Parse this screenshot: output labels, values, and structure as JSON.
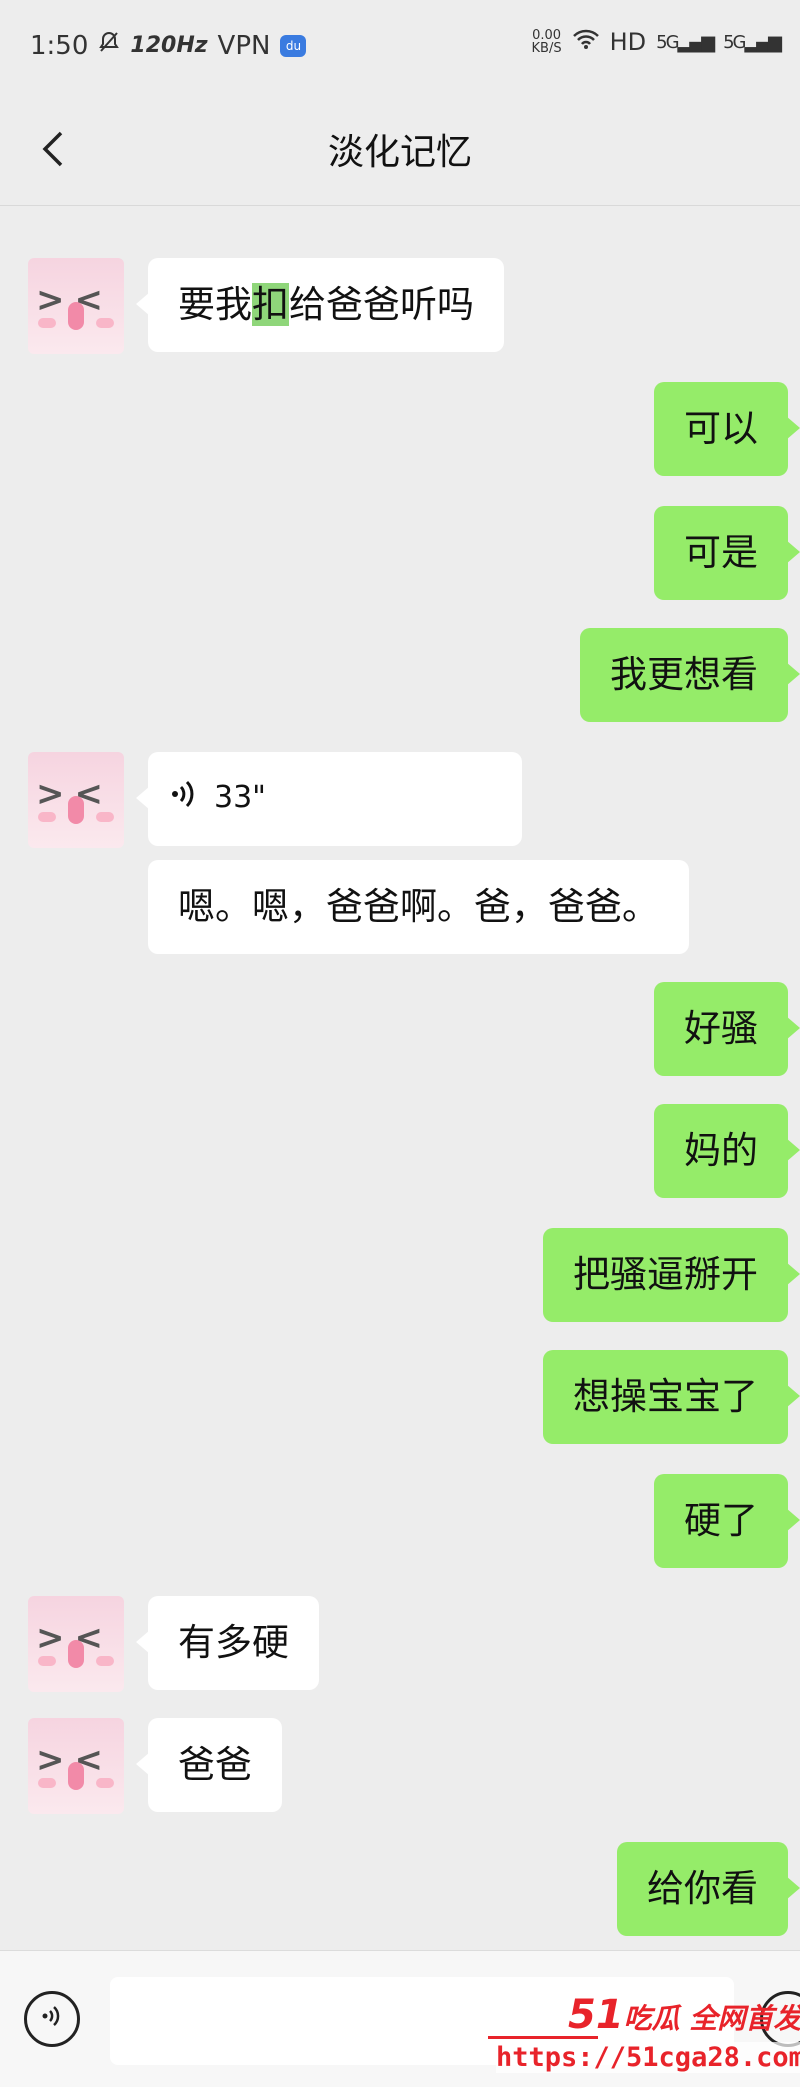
{
  "status_bar": {
    "time": "1:50",
    "mute_icon": "bell-slash-icon",
    "refresh_rate": "120Hz",
    "vpn": "VPN",
    "net_speed_value": "0.00",
    "net_speed_unit": "KB/S",
    "hd": "HD",
    "signal_1": "5G",
    "signal_2": "5G"
  },
  "header": {
    "back_icon": "chevron-left-icon",
    "title": "淡化记忆"
  },
  "messages": [
    {
      "side": "in",
      "type": "text",
      "pre": "要我",
      "highlight": "扣",
      "post": "给爸爸听吗"
    },
    {
      "side": "out",
      "type": "text",
      "text": "可以"
    },
    {
      "side": "out",
      "type": "text",
      "text": "可是"
    },
    {
      "side": "out",
      "type": "text",
      "text": "我更想看"
    },
    {
      "side": "in",
      "type": "voice",
      "duration": "33\"",
      "icon": "voice-wave-icon"
    },
    {
      "side": "in",
      "type": "text",
      "text": "嗯。嗯，爸爸啊。爸，爸爸。"
    },
    {
      "side": "out",
      "type": "text",
      "text": "好骚"
    },
    {
      "side": "out",
      "type": "text",
      "text": "妈的"
    },
    {
      "side": "out",
      "type": "text",
      "text": "把骚逼掰开"
    },
    {
      "side": "out",
      "type": "text",
      "text": "想操宝宝了"
    },
    {
      "side": "out",
      "type": "text",
      "text": "硬了"
    },
    {
      "side": "in",
      "type": "text",
      "text": "有多硬"
    },
    {
      "side": "in",
      "type": "text",
      "text": "爸爸"
    },
    {
      "side": "out",
      "type": "text",
      "text": "给你看"
    }
  ],
  "input_bar": {
    "voice_icon": "voice-input-icon",
    "placeholder": "",
    "emoji_icon": "emoji-icon"
  },
  "watermark": {
    "brand_number": "51",
    "brand_text": "吃瓜 全网首发",
    "url": "https://51cga28.com"
  }
}
